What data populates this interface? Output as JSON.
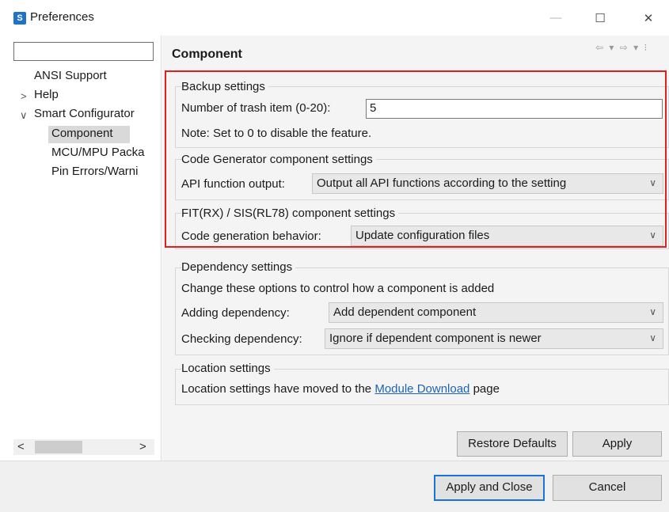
{
  "window": {
    "title": "Preferences",
    "icon_letter": "S",
    "minimize_glyph": "—",
    "maximize_glyph": "☐",
    "close_glyph": "✕"
  },
  "sidebar": {
    "filter_value": "",
    "items": [
      {
        "label": "ANSI Support"
      },
      {
        "label": "Help",
        "arrow": ">"
      },
      {
        "label": "Smart Configurator",
        "arrow": "∨"
      },
      {
        "label": "Component"
      },
      {
        "label": "MCU/MPU Packa"
      },
      {
        "label": "Pin Errors/Warni"
      }
    ],
    "scroll_left": "<",
    "scroll_right": ">"
  },
  "page": {
    "title": "Component",
    "nav_glyphs": "⇦ ▾ ⇨ ▾ ⁝"
  },
  "backup": {
    "title": "Backup settings",
    "trash_label": "Number of trash item (0-20):",
    "trash_value": "5",
    "note": "Note: Set to 0 to disable the feature."
  },
  "codegen": {
    "title": "Code Generator component settings",
    "api_label": "API function output:",
    "api_value": "Output all API functions according to the setting"
  },
  "fit": {
    "title": "FIT(RX) / SIS(RL78) component settings",
    "behavior_label": "Code generation behavior:",
    "behavior_value": "Update configuration files"
  },
  "dependency": {
    "title": "Dependency settings",
    "desc": "Change these options to control how a component is added",
    "adding_label": "Adding dependency:",
    "adding_value": "Add dependent component",
    "checking_label": "Checking dependency:",
    "checking_value": "Ignore if dependent component is newer"
  },
  "location": {
    "title": "Location settings",
    "text_before": "Location settings have moved to the ",
    "link": "Module Download",
    "text_after": " page"
  },
  "buttons": {
    "restore": "Restore Defaults",
    "apply": "Apply",
    "apply_close": "Apply and Close",
    "cancel": "Cancel"
  },
  "combo_arrow": "∨",
  "colors": {
    "highlight": "#e02020",
    "link": "#1e63b4",
    "default_button_border": "#1a73d9"
  }
}
